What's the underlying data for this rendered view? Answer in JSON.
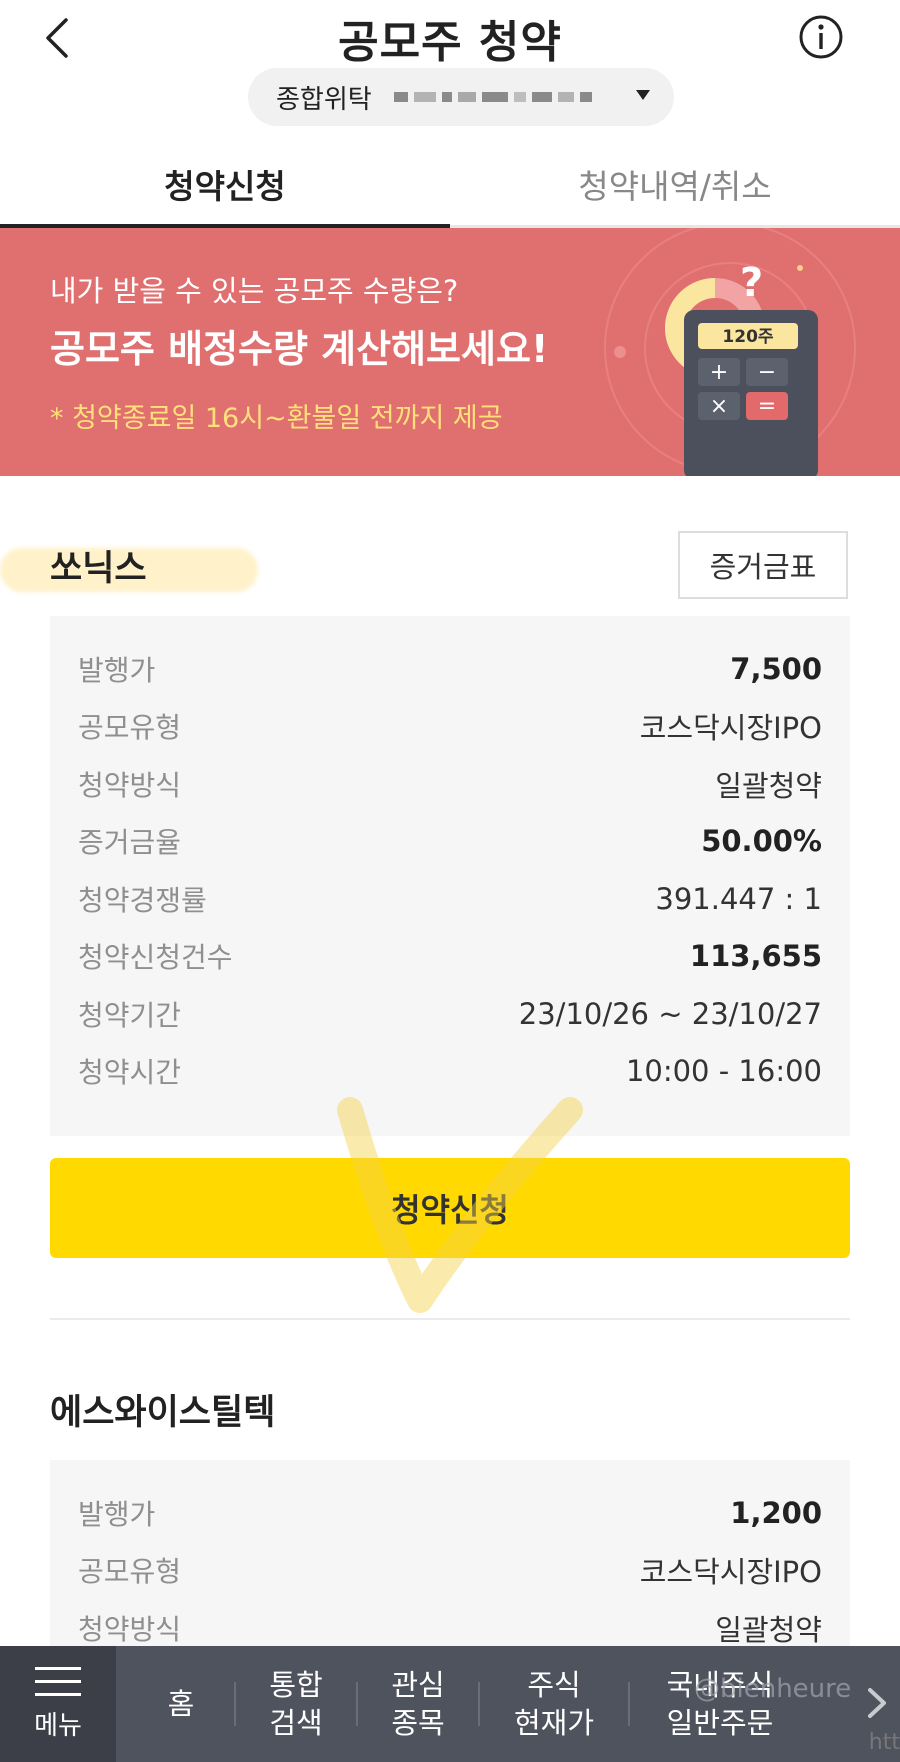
{
  "header": {
    "title": "공모주 청약",
    "account_type": "종합위탁"
  },
  "tabs": [
    {
      "label": "청약신청",
      "active": true
    },
    {
      "label": "청약내역/취소",
      "active": false
    }
  ],
  "banner": {
    "question": "내가 받을 수 있는 공모주 수량은?",
    "headline": "공모주 배정수량 계산해보세요!",
    "note": "* 청약종료일 16시~환불일 전까지 제공",
    "calculator_display": "120주",
    "calc_keys": [
      "+",
      "−",
      "×",
      "="
    ]
  },
  "offerings": [
    {
      "name": "쏘닉스",
      "margin_button": "증거금표",
      "rows": [
        {
          "label": "발행가",
          "value": "7,500",
          "bold": true
        },
        {
          "label": "공모유형",
          "value": "코스닥시장IPO",
          "bold": false
        },
        {
          "label": "청약방식",
          "value": "일괄청약",
          "bold": false
        },
        {
          "label": "증거금율",
          "value": "50.00%",
          "bold": true
        },
        {
          "label": "청약경쟁률",
          "value": "391.447 : 1",
          "bold": false
        },
        {
          "label": "청약신청건수",
          "value": "113,655",
          "bold": true
        },
        {
          "label": "청약기간",
          "value": "23/10/26 ~ 23/10/27",
          "bold": false
        },
        {
          "label": "청약시간",
          "value": "10:00 - 16:00",
          "bold": false
        }
      ],
      "apply_button": "청약신청"
    },
    {
      "name": "에스와이스틸텍",
      "rows": [
        {
          "label": "발행가",
          "value": "1,200",
          "bold": true
        },
        {
          "label": "공모유형",
          "value": "코스닥시장IPO",
          "bold": false
        },
        {
          "label": "청약방식",
          "value": "일괄청약",
          "bold": false
        }
      ]
    }
  ],
  "bottom_nav": {
    "menu": "메뉴",
    "items": [
      "홈",
      "통합\n검색",
      "관심\n종목",
      "주식\n현재가",
      "국내주식\n일반주문"
    ]
  },
  "overlay": {
    "credit": "@bienheure",
    "credit_cut": "htt"
  },
  "colors": {
    "banner": "#e06f6f",
    "apply_button": "#ffd900",
    "nav_bg": "#4f535e"
  }
}
